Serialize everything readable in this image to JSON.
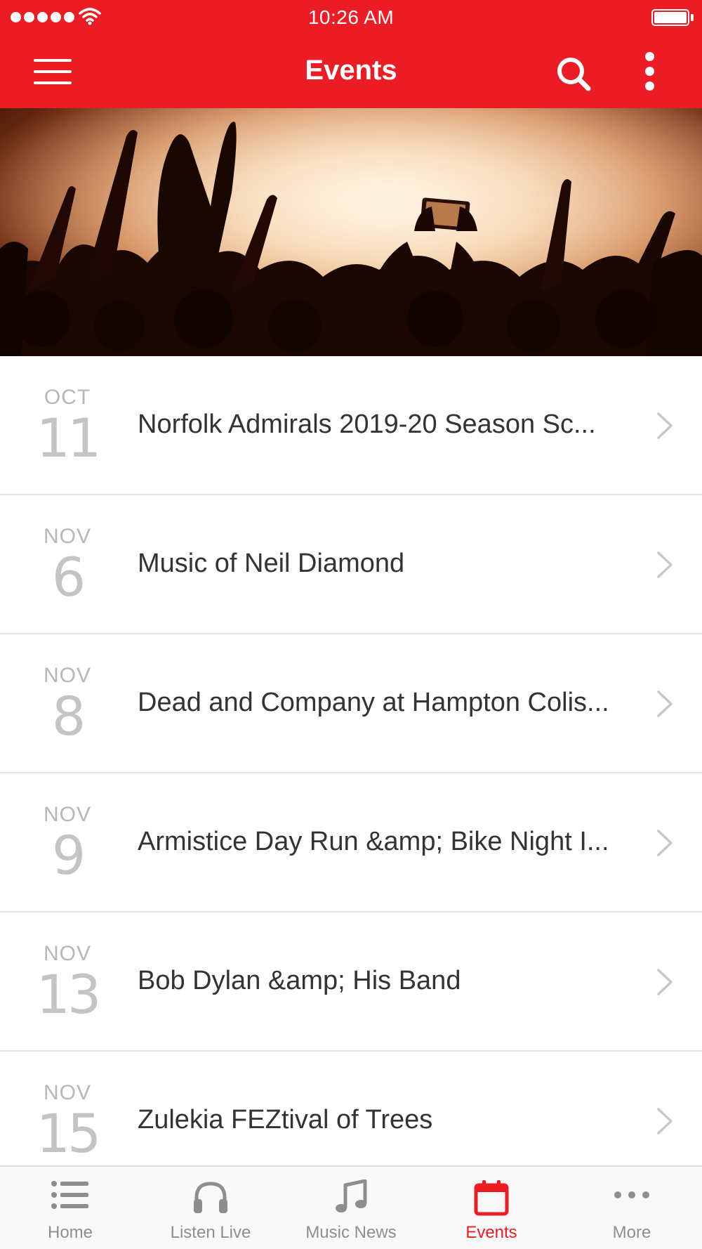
{
  "status_bar": {
    "time": "10:26 AM"
  },
  "nav": {
    "title": "Events",
    "icons": [
      "menu-icon",
      "search-icon",
      "more-vertical-icon"
    ]
  },
  "hero": {
    "description_icon": "concert-crowd-image"
  },
  "events": [
    {
      "month": "OCT",
      "day": "11",
      "title": "Norfolk Admirals 2019-20 Season Sc..."
    },
    {
      "month": "NOV",
      "day": "6",
      "title": "Music of Neil Diamond"
    },
    {
      "month": "NOV",
      "day": "8",
      "title": "Dead and Company at Hampton Colis..."
    },
    {
      "month": "NOV",
      "day": "9",
      "title": "Armistice Day Run &amp; Bike Night I..."
    },
    {
      "month": "NOV",
      "day": "13",
      "title": "Bob Dylan &amp; His Band"
    },
    {
      "month": "NOV",
      "day": "15",
      "title": "Zulekia FEZtival of Trees"
    }
  ],
  "tabs": [
    {
      "label": "Home",
      "icon": "list-icon",
      "active": false
    },
    {
      "label": "Listen Live",
      "icon": "headphones-icon",
      "active": false
    },
    {
      "label": "Music News",
      "icon": "music-note-icon",
      "active": false
    },
    {
      "label": "Events",
      "icon": "calendar-icon",
      "active": true
    },
    {
      "label": "More",
      "icon": "more-horizontal-icon",
      "active": false
    }
  ],
  "colors": {
    "brand": "#ec1c24",
    "inactive": "#8e8e8e",
    "divider": "#e4e4e4"
  }
}
